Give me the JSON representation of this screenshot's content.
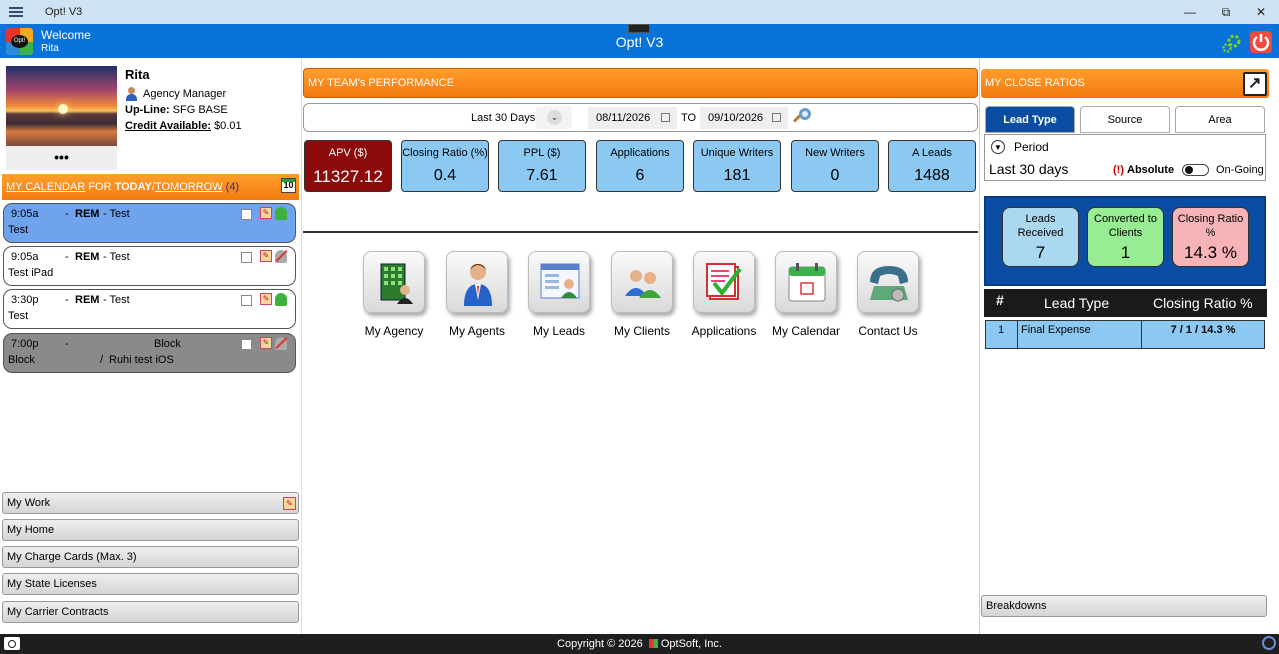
{
  "window": {
    "title": "Opt! V3",
    "minimize": "—",
    "restore": "⧉",
    "close": "✕"
  },
  "header": {
    "welcome": "Welcome",
    "user": "Rita",
    "app_title": "Opt! V3"
  },
  "profile": {
    "name": "Rita",
    "role": "Agency Manager",
    "upline_label": "Up-Line:",
    "upline_value": "SFG BASE",
    "credit_label": "Credit Available:",
    "credit_value": "$0.01",
    "more": "•••"
  },
  "calendar": {
    "label_my_calendar": "MY CALENDAR",
    "label_for": " FOR ",
    "label_today": "TODAY",
    "label_sep": "/",
    "label_tomorrow": "TOMORROW",
    "count": " (4)",
    "icon_day": "10",
    "items": [
      {
        "time": "9:05a",
        "dash": "-",
        "kind": "REM",
        "title": "- Test",
        "who": "Test",
        "bg": "#6fa3ee",
        "bell": "on"
      },
      {
        "time": "9:05a",
        "dash": "-",
        "kind": "REM",
        "title": "- Test",
        "who": "Test iPad",
        "bg": "#ffffff",
        "bell": "off"
      },
      {
        "time": "3:30p",
        "dash": "-",
        "kind": "REM",
        "title": "- Test",
        "who": "Test",
        "bg": "#ffffff",
        "bell": "on"
      },
      {
        "time": "7:00p",
        "dash": "-",
        "title2": "Block",
        "who": "Block",
        "slash": "/",
        "extra": "Ruhi test iOS",
        "bg": "#8a8a8a",
        "bell": "off"
      }
    ]
  },
  "left_menu": [
    "My Work",
    "My Home",
    "My Charge Cards (Max. 3)",
    "My State Licenses",
    "My Carrier Contracts"
  ],
  "team": {
    "header": "MY TEAM's PERFORMANCE",
    "period": "Last 30 Days",
    "date_from": "08/11/2026",
    "to_label": "TO",
    "date_to": "09/10/2026",
    "kpis": [
      {
        "label": "APV ($)",
        "value": "11327.12"
      },
      {
        "label": "Closing Ratio (%)",
        "value": "0.4"
      },
      {
        "label": "PPL ($)",
        "value": "7.61"
      },
      {
        "label": "Applications",
        "value": "6"
      },
      {
        "label": "Unique Writers",
        "value": "181"
      },
      {
        "label": "New Writers",
        "value": "0"
      },
      {
        "label": "A Leads",
        "value": "1488"
      }
    ]
  },
  "apps": [
    {
      "label": "My Agency",
      "icon": "building-icon"
    },
    {
      "label": "My Agents",
      "icon": "agent-icon"
    },
    {
      "label": "My Leads",
      "icon": "leads-icon"
    },
    {
      "label": "My Clients",
      "icon": "clients-icon"
    },
    {
      "label": "Applications",
      "icon": "applications-icon"
    },
    {
      "label": "My Calendar",
      "icon": "calendar-icon"
    },
    {
      "label": "Contact Us",
      "icon": "phone-icon"
    }
  ],
  "close_ratios": {
    "header": "MY CLOSE RATIOS",
    "tabs": [
      "Lead Type",
      "Source",
      "Area"
    ],
    "period_title": "Period",
    "period_value": "Last 30 days",
    "absolute_icon": "(!)",
    "absolute_label": "Absolute",
    "ongoing_label": "On-Going",
    "stats": [
      {
        "label": "Leads Received",
        "value": "7",
        "color": "#a9d8f0"
      },
      {
        "label": "Converted to Clients",
        "value": "1",
        "color": "#98ec93"
      },
      {
        "label": "Closing Ratio %",
        "value": "14.3 %",
        "color": "#f6b4b8"
      }
    ],
    "table_headers": [
      "#",
      "Lead Type",
      "Closing Ratio %"
    ],
    "rows": [
      {
        "num": "1",
        "type": "Final Expense",
        "ratio": "7 / 1 / 14.3 %"
      }
    ],
    "breakdowns": "Breakdowns"
  },
  "footer": {
    "copyright": "Copyright © 2026",
    "company": "OptSoft, Inc."
  },
  "colors": {
    "accent_orange": "#f27a0e",
    "header_blue": "#0a73d9",
    "kpi_blue": "#8cc9f2",
    "apv_red": "#8c0a0a"
  }
}
